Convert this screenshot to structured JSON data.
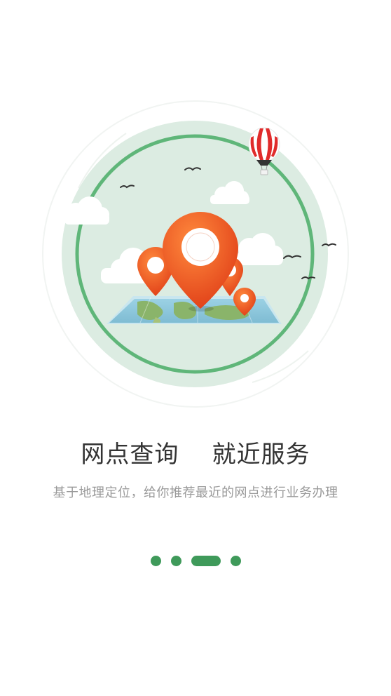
{
  "onboarding": {
    "title": "网点查询    就近服务",
    "subtitle": "基于地理定位，给你推荐最近的网点进行业务办理",
    "pager": {
      "pages": 4,
      "active_index": 2
    }
  },
  "colors": {
    "accent_green": "#3f9a5a",
    "pin_orange": "#e9501c",
    "balloon_red": "#e02b2b",
    "map_blue": "#8fc9df",
    "circle_fill": "#dcece2"
  },
  "icons": [
    "location-pin-icon",
    "map-icon",
    "hot-air-balloon-icon",
    "cloud-icon",
    "bird-icon"
  ]
}
